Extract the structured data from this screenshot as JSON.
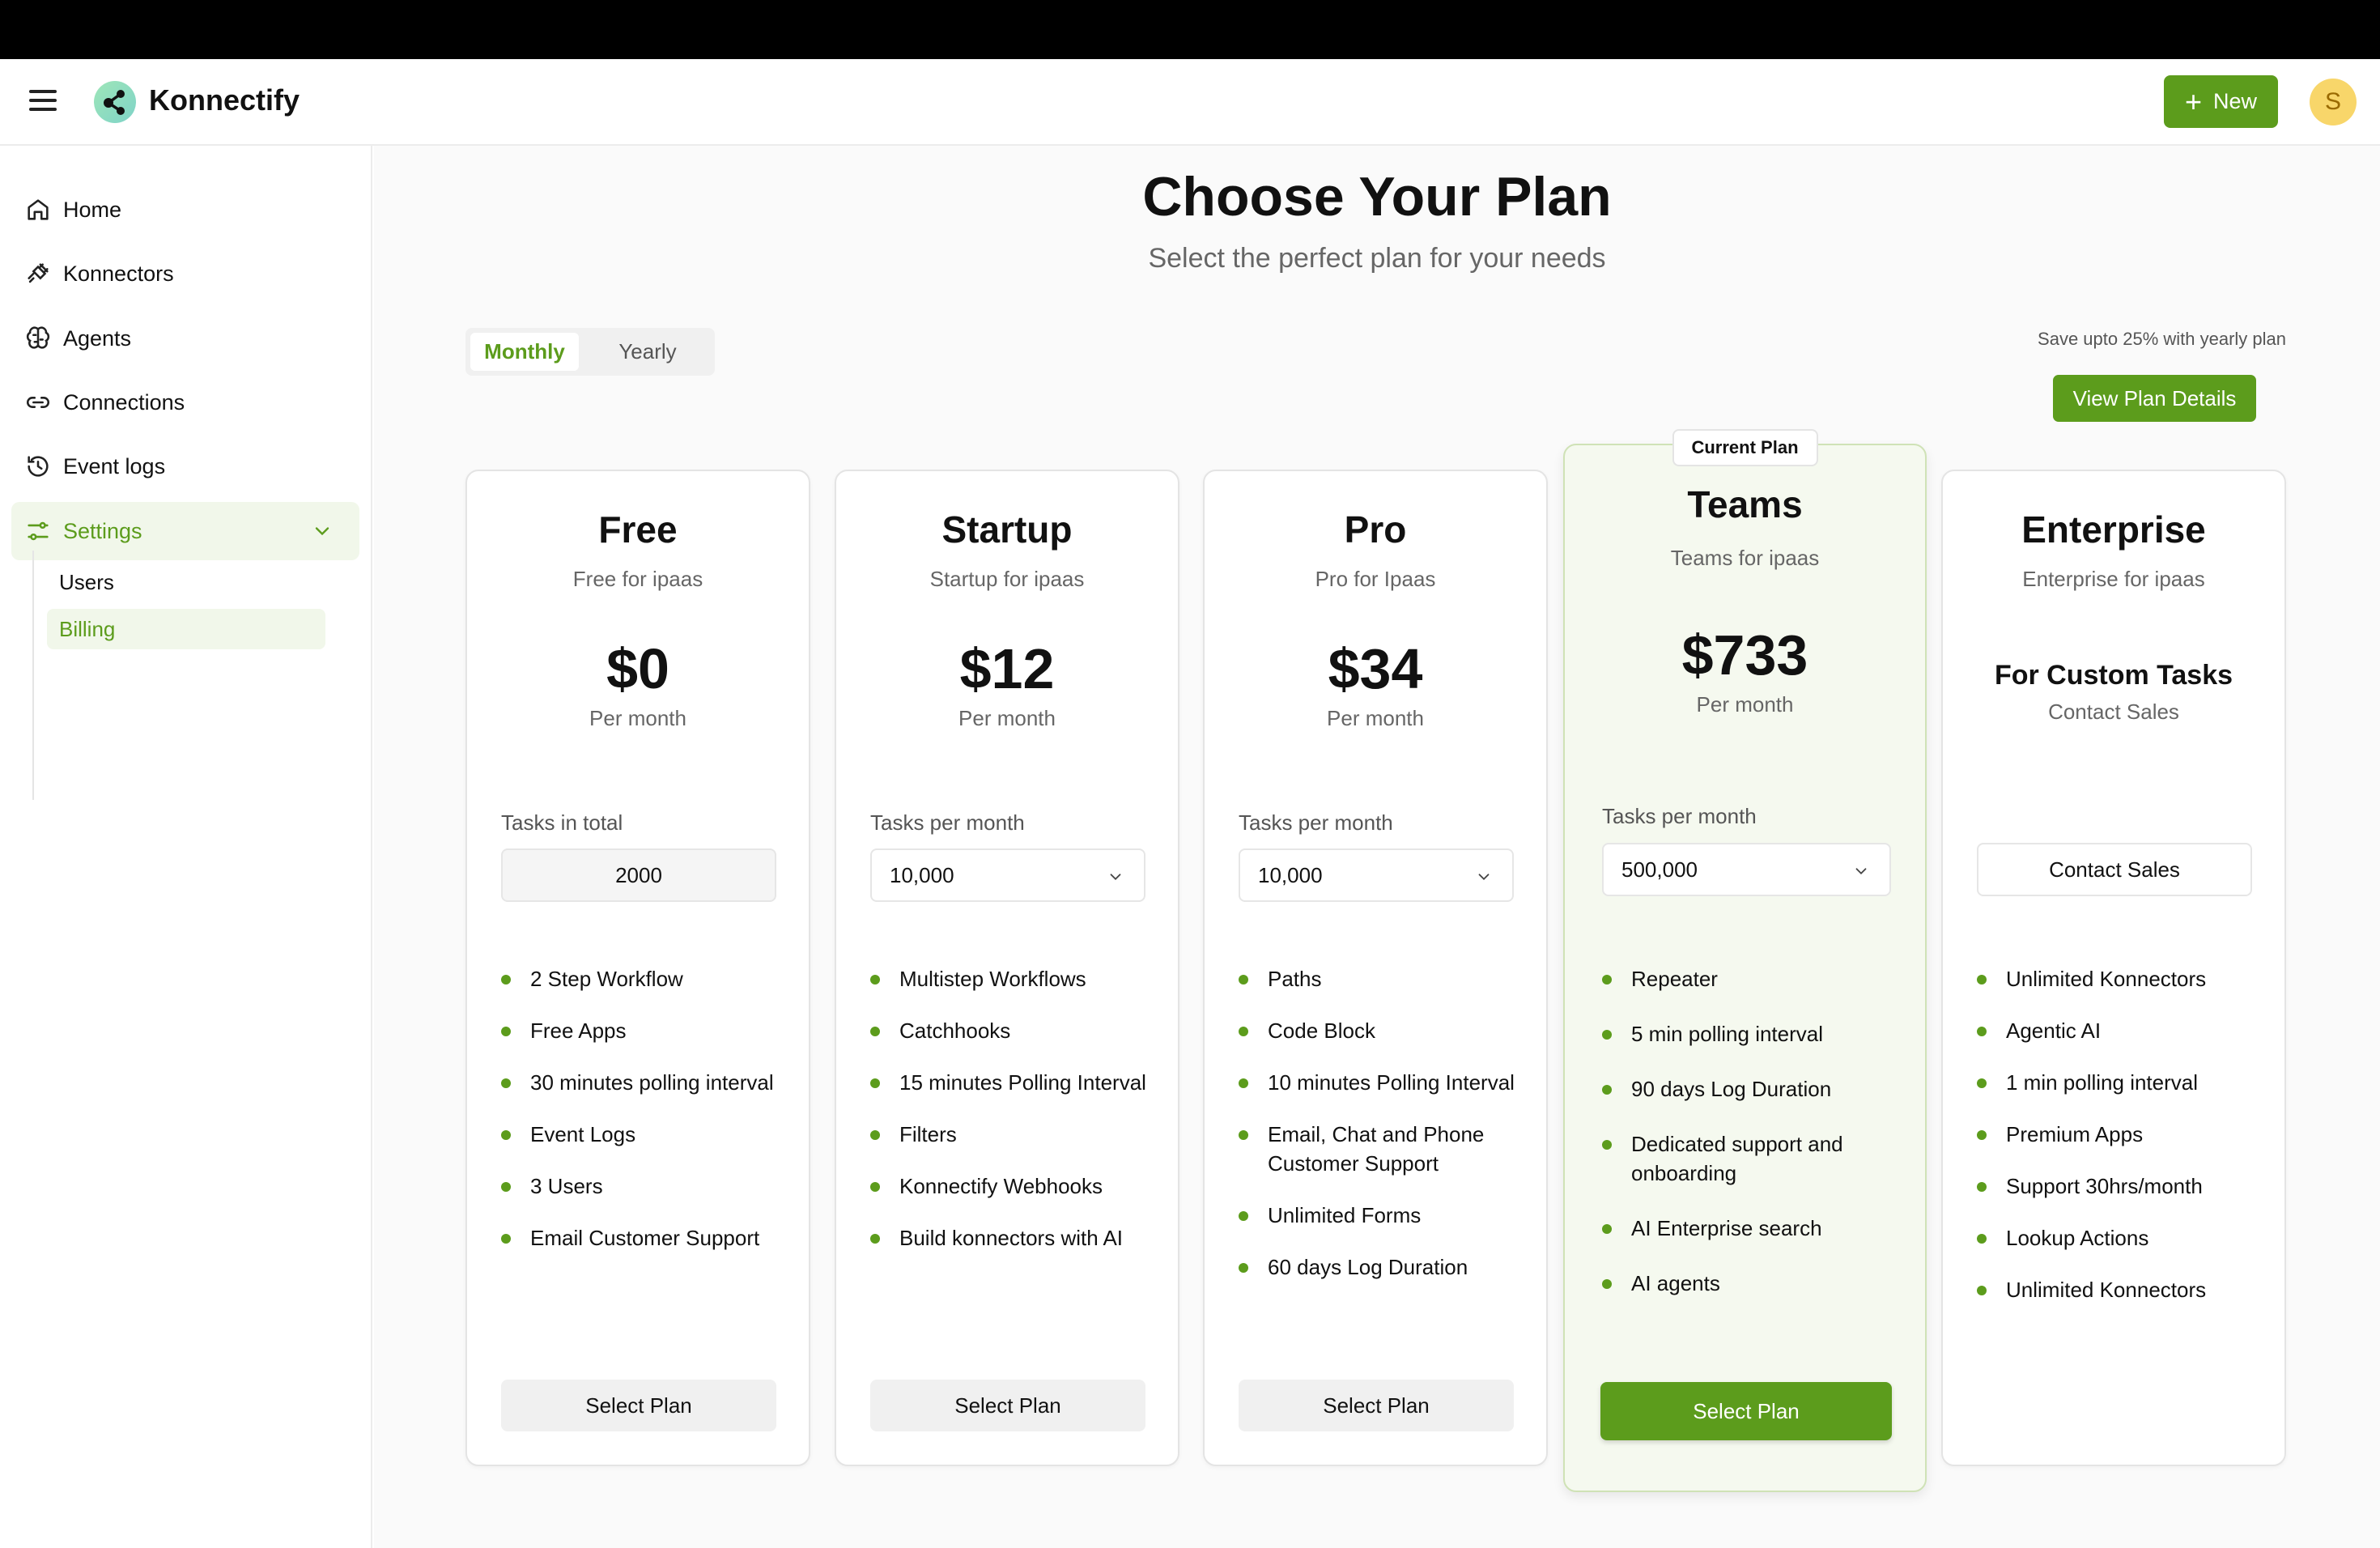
{
  "app": {
    "brand": "Konnectify",
    "new_label": "New",
    "avatar_initial": "S",
    "accent": "#5c9c1c"
  },
  "sidebar": {
    "items": [
      {
        "label": "Home",
        "icon": "home-icon"
      },
      {
        "label": "Konnectors",
        "icon": "plug-icon"
      },
      {
        "label": "Agents",
        "icon": "brain-icon"
      },
      {
        "label": "Connections",
        "icon": "link-icon"
      },
      {
        "label": "Event logs",
        "icon": "history-icon"
      },
      {
        "label": "Settings",
        "icon": "sliders-icon"
      }
    ],
    "sub_items": [
      {
        "label": "Users"
      },
      {
        "label": "Billing"
      }
    ]
  },
  "main": {
    "title": "Choose Your Plan",
    "subtitle": "Select the perfect plan for your needs",
    "billing_toggle": {
      "monthly": "Monthly",
      "yearly": "Yearly",
      "selected": "Monthly"
    },
    "save_note": "Save upto 25% with yearly plan",
    "view_details_label": "View Plan Details",
    "current_plan_badge": "Current Plan"
  },
  "plans": [
    {
      "name": "Free",
      "desc": "Free for ipaas",
      "price": "$0",
      "per": "Per month",
      "task_label": "Tasks in total",
      "task_value": "2000",
      "features": [
        "2 Step Workflow",
        "Free Apps",
        "30 minutes polling interval",
        "Event Logs",
        "3 Users",
        "Email Customer Support"
      ],
      "cta": "Select Plan"
    },
    {
      "name": "Startup",
      "desc": "Startup for ipaas",
      "price": "$12",
      "per": "Per month",
      "task_label": "Tasks per month",
      "task_value": "10,000",
      "features": [
        "Multistep Workflows",
        "Catchhooks",
        "15 minutes Polling Interval",
        "Filters",
        "Konnectify Webhooks",
        "Build konnectors with AI"
      ],
      "cta": "Select Plan"
    },
    {
      "name": "Pro",
      "desc": "Pro for Ipaas",
      "price": "$34",
      "per": "Per month",
      "task_label": "Tasks per month",
      "task_value": "10,000",
      "features": [
        "Paths",
        "Code Block",
        "10 minutes Polling Interval",
        "Email, Chat and Phone Customer Support",
        "Unlimited Forms",
        "60 days Log Duration"
      ],
      "cta": "Select Plan"
    },
    {
      "name": "Teams",
      "desc": "Teams for ipaas",
      "price": "$733",
      "per": "Per month",
      "task_label": "Tasks per month",
      "task_value": "500,000",
      "features": [
        "Repeater",
        "5 min polling interval",
        "90 days Log Duration",
        "Dedicated support and onboarding",
        "AI Enterprise search",
        "AI agents"
      ],
      "cta": "Select Plan"
    },
    {
      "name": "Enterprise",
      "desc": "Enterprise for ipaas",
      "custom": "For Custom Tasks",
      "per": "Contact Sales",
      "contact_label": "Contact Sales",
      "features": [
        "Unlimited Konnectors",
        "Agentic AI",
        "1 min polling interval",
        "Premium Apps",
        "Support 30hrs/month",
        "Lookup Actions",
        "Unlimited Konnectors"
      ]
    }
  ]
}
